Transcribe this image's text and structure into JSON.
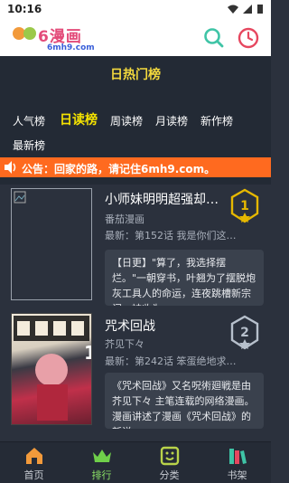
{
  "status_bar": {
    "time": "10:16"
  },
  "app": {
    "brand": "6漫画",
    "site": "6mh9.com",
    "accent": "#3fc4a6"
  },
  "rank": {
    "title": "日热门榜",
    "tabs": [
      "人气榜",
      "日读榜",
      "周读榜",
      "月读榜",
      "新作榜",
      "最新榜"
    ],
    "active_tab": "日读榜"
  },
  "notice": {
    "text": "公告：回家的路，请记住6mh9.com。"
  },
  "items": [
    {
      "title": "小师妹明明超强却过分沙雕",
      "author": "番茄漫画",
      "latest": "最新：第152话 我是你们这…",
      "rank": "1",
      "desc": "【日更】\"算了，我选择摆烂。\"一朝穿书，叶翘为了摆脱炮灰工具人的命运，连夜跳槽新宗门，被收为…"
    },
    {
      "title": "咒术回战",
      "author": "芥见下々",
      "latest": "最新：第242话 笨蛋绝地求…",
      "rank": "2",
      "desc": "《咒术回战》又名呪術廻戦是由芥见下々 主笔连载的网络漫画。漫画讲述了漫画《咒术回战》的新说…"
    }
  ],
  "nav": [
    {
      "label": "首页",
      "icon": "home-icon"
    },
    {
      "label": "排行",
      "icon": "crown-icon",
      "active": true
    },
    {
      "label": "分类",
      "icon": "category-icon"
    },
    {
      "label": "书架",
      "icon": "bookshelf-icon"
    }
  ]
}
